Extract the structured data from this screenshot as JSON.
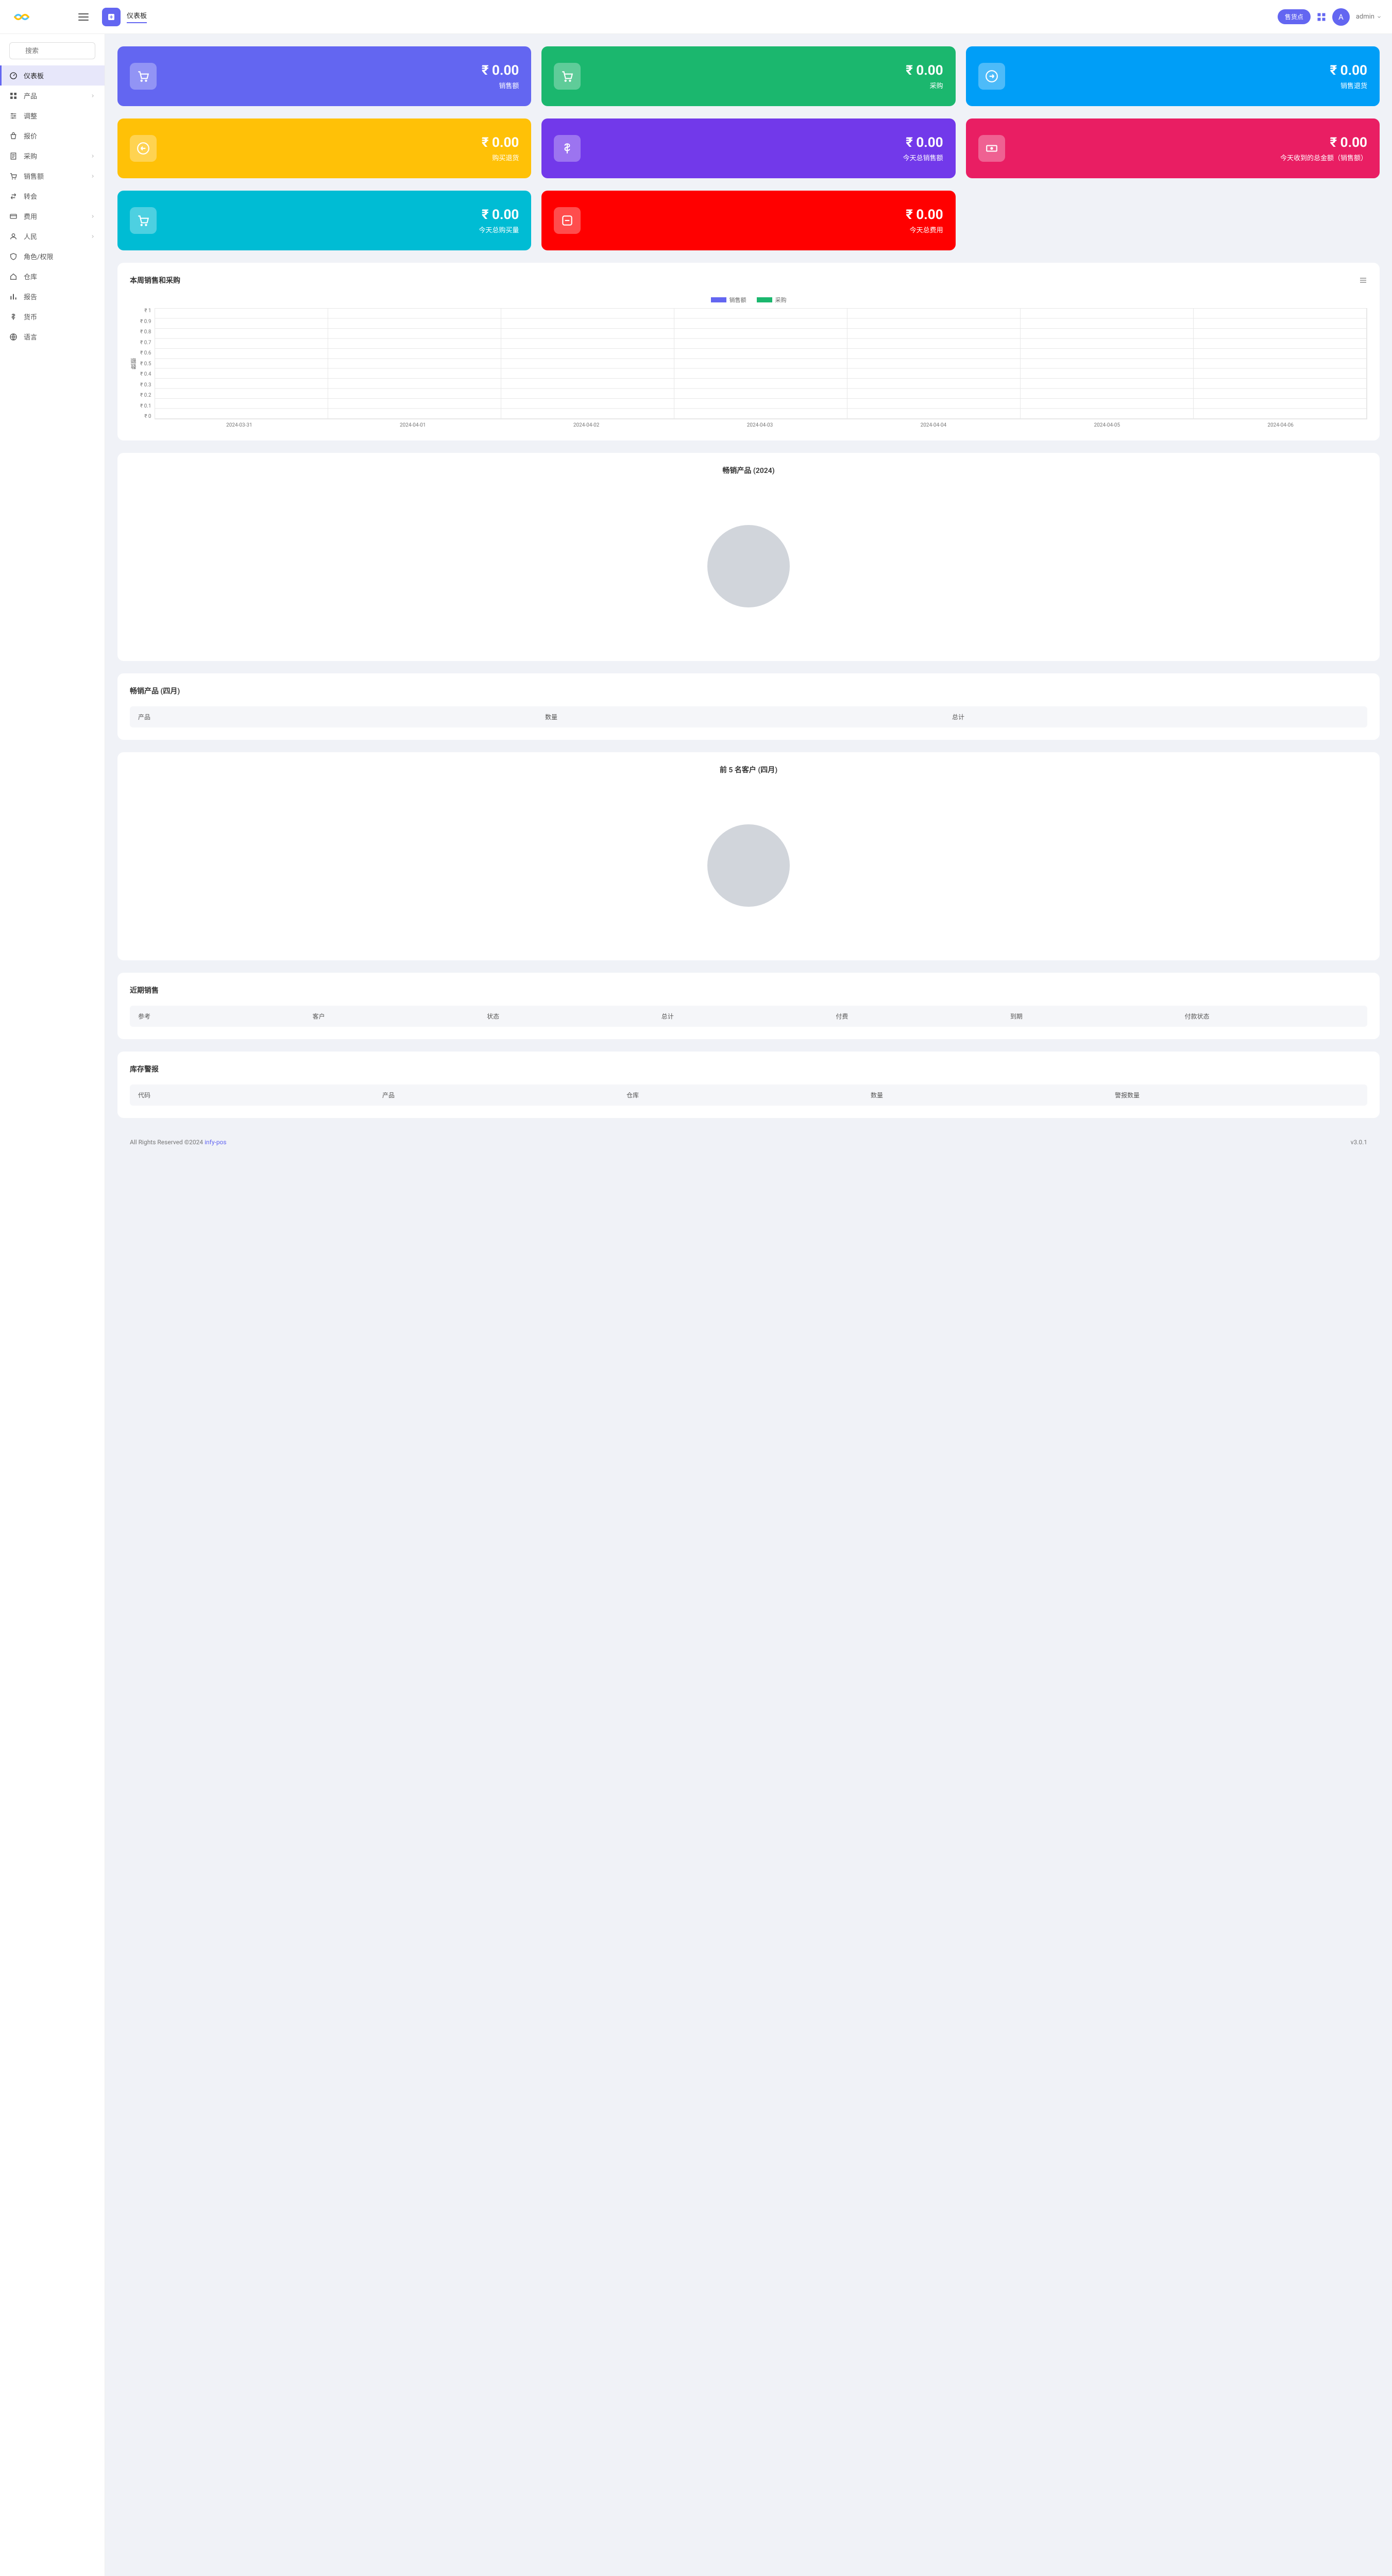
{
  "header": {
    "tab_label": "仪表板",
    "pos_btn": "售货点",
    "avatar_letter": "A",
    "user_name": "admin"
  },
  "sidebar": {
    "search_placeholder": "搜索",
    "items": [
      {
        "label": "仪表板",
        "active": true,
        "icon": "speed",
        "expand": false
      },
      {
        "label": "产品",
        "active": false,
        "icon": "grid",
        "expand": true
      },
      {
        "label": "调整",
        "active": false,
        "icon": "adjust",
        "expand": false
      },
      {
        "label": "报价",
        "active": false,
        "icon": "basket",
        "expand": false
      },
      {
        "label": "采购",
        "active": false,
        "icon": "doc",
        "expand": true
      },
      {
        "label": "销售额",
        "active": false,
        "icon": "cart",
        "expand": true
      },
      {
        "label": "转会",
        "active": false,
        "icon": "transfer",
        "expand": false
      },
      {
        "label": "费用",
        "active": false,
        "icon": "card",
        "expand": true
      },
      {
        "label": "人民",
        "active": false,
        "icon": "person",
        "expand": true
      },
      {
        "label": "角色/权限",
        "active": false,
        "icon": "shield",
        "expand": false
      },
      {
        "label": "仓库",
        "active": false,
        "icon": "home",
        "expand": false
      },
      {
        "label": "报告",
        "active": false,
        "icon": "bars",
        "expand": false
      },
      {
        "label": "货币",
        "active": false,
        "icon": "dollar",
        "expand": false
      },
      {
        "label": "语言",
        "active": false,
        "icon": "lang",
        "expand": false
      }
    ]
  },
  "stats": [
    {
      "value": "₹ 0.00",
      "label": "销售额",
      "color": "c-indigo",
      "icon": "cart"
    },
    {
      "value": "₹ 0.00",
      "label": "采购",
      "color": "c-green",
      "icon": "cart"
    },
    {
      "value": "₹ 0.00",
      "label": "销售退货",
      "color": "c-blue",
      "icon": "arrow-right"
    },
    {
      "value": "₹ 0.00",
      "label": "购买退货",
      "color": "c-yellow",
      "icon": "arrow-left"
    },
    {
      "value": "₹ 0.00",
      "label": "今天总销售额",
      "color": "c-purple",
      "icon": "dollar"
    },
    {
      "value": "₹ 0.00",
      "label": "今天收到的总金额（销售额）",
      "color": "c-pink",
      "icon": "money"
    },
    {
      "value": "₹ 0.00",
      "label": "今天总购买量",
      "color": "c-cyan",
      "icon": "cart"
    },
    {
      "value": "₹ 0.00",
      "label": "今天总费用",
      "color": "c-red",
      "icon": "minus"
    }
  ],
  "chart_data": {
    "type": "bar",
    "title": "本周销售和采购",
    "ylabel": "数额",
    "categories": [
      "2024-03-31",
      "2024-04-01",
      "2024-04-02",
      "2024-04-03",
      "2024-04-04",
      "2024-04-05",
      "2024-04-06"
    ],
    "yticks": [
      "₹ 1",
      "₹ 0.9",
      "₹ 0.8",
      "₹ 0.7",
      "₹ 0.6",
      "₹ 0.5",
      "₹ 0.4",
      "₹ 0.3",
      "₹ 0.2",
      "₹ 0.1",
      "₹ 0"
    ],
    "ylim": [
      0,
      1
    ],
    "series": [
      {
        "name": "销售额",
        "color": "#6366f1",
        "values": [
          0,
          0,
          0,
          0,
          0,
          0,
          0
        ]
      },
      {
        "name": "采购",
        "color": "#1bb76e",
        "values": [
          0,
          0,
          0,
          0,
          0,
          0,
          0
        ]
      }
    ]
  },
  "panels": {
    "top_selling_year": "畅销产品 (2024)",
    "top_selling_month": "畅销产品 (四月)",
    "top_customers": "前 5 名客户 (四月)",
    "recent_sales": "近期销售",
    "stock_alert": "库存警报"
  },
  "tables": {
    "top_selling_month_cols": [
      "产品",
      "数量",
      "总计"
    ],
    "recent_sales_cols": [
      "参考",
      "客户",
      "状态",
      "总计",
      "付费",
      "到期",
      "付款状态"
    ],
    "stock_alert_cols": [
      "代码",
      "产品",
      "仓库",
      "数量",
      "警报数量"
    ]
  },
  "footer": {
    "copyright": "All Rights Reserved ©2024 ",
    "link": "infy-pos",
    "version": "v3.0.1"
  }
}
